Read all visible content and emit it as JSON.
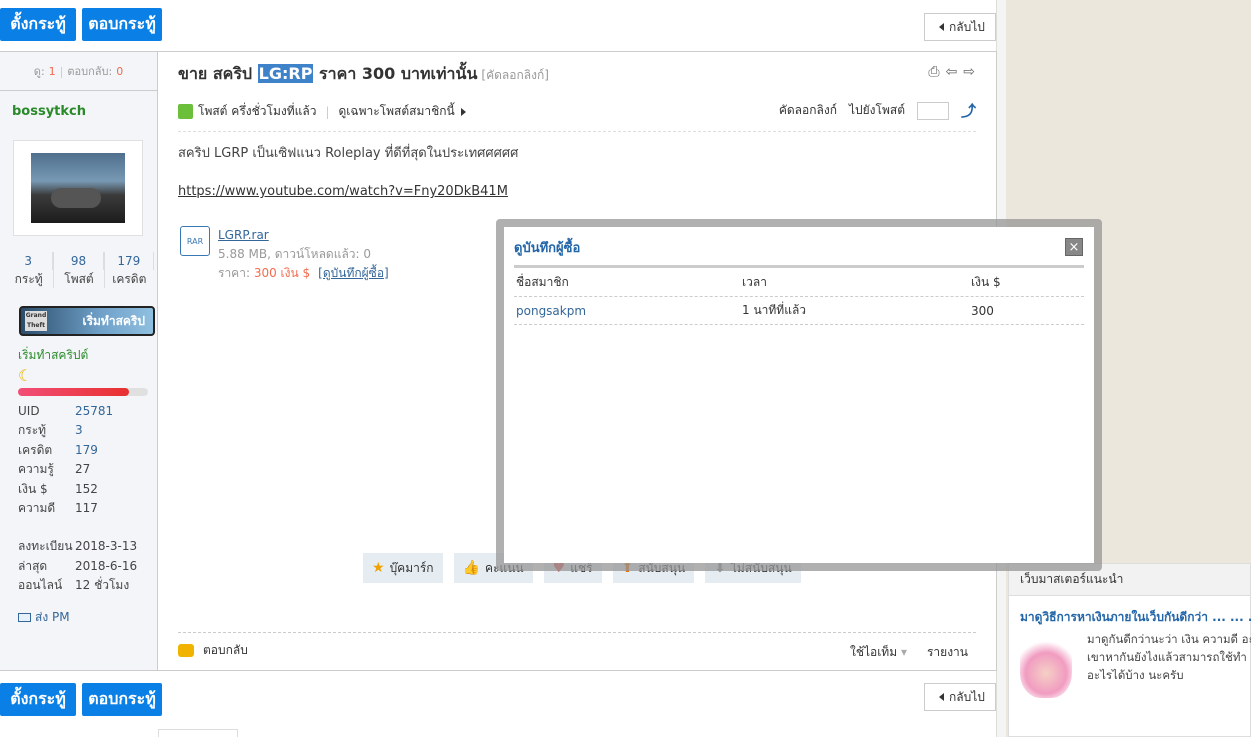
{
  "toolbar": {
    "new_thread": "ตั้งกระทู้",
    "reply": "ตอบกระทู้",
    "back": "กลับไป"
  },
  "left": {
    "views_label": "ดู:",
    "views": "1",
    "replies_label": "ตอบกลับ:",
    "replies": "0",
    "username": "bossytkch",
    "stats": [
      {
        "value": "3",
        "label": "กระทู้"
      },
      {
        "value": "98",
        "label": "โพสต์"
      },
      {
        "value": "179",
        "label": "เครดิต"
      }
    ],
    "badge_text": "เริ่มทำสคริป",
    "rank_title": "เริ่มทำสคริปต์",
    "progress": 0.85,
    "info": [
      {
        "k": "UID",
        "v": "25781"
      },
      {
        "k": "กระทู้",
        "v": "3"
      },
      {
        "k": "เครดิต",
        "v": "179"
      },
      {
        "k": "ความรู้",
        "v": "27"
      },
      {
        "k": "เงิน $",
        "v": "152"
      },
      {
        "k": "ความดี",
        "v": "117"
      }
    ],
    "info2": [
      {
        "k": "ลงทะเบียน",
        "v": "2018-3-13"
      },
      {
        "k": "ล่าสุด",
        "v": "2018-6-16"
      },
      {
        "k": "ออนไลน์",
        "v": "12 ชั่วโมง"
      }
    ],
    "pm": "ส่ง PM"
  },
  "post": {
    "title_prefix": "ขาย สคริป",
    "title_highlight": "LG:RP",
    "title_suffix": "ราคา 300 บาทเท่านั้น",
    "copy_link_small": "[คัดลอกลิงก์]",
    "posted_time": "โพสต์ ครึ่งชั่วโมงที่แล้ว",
    "only_member": "ดูเฉพาะโพสต์สมาชิกนี้",
    "copy_link": "คัดลอกลิงก์",
    "goto_post": "ไปยังโพสต์",
    "body": "สคริป LGRP เป็นเซิฟแนว Roleplay ที่ดีที่สุดในประเทศศศศศ",
    "link": "https://www.youtube.com/watch?v=Fny20DkB41M",
    "attach": {
      "icon_text": "RAR",
      "name": "LGRP.rar",
      "size": "5.88 MB, ดาวน์โหลดแล้ว: 0",
      "price_label": "ราคา:",
      "price": "300 เงิน $",
      "buyers": "[ดูบันทึกผู้ซื้อ]"
    },
    "actions": [
      "บุ๊คมาร์ก",
      "คะแนน",
      "แชร์",
      "สนับสนุน",
      "ไม่สนับสนุน"
    ],
    "reply": "ตอบกลับ",
    "use_item": "ใช้ไอเท็ม",
    "report": "รายงาน"
  },
  "modal": {
    "title": "ดูบันทึกผู้ซื้อ",
    "close": "×",
    "headers": [
      "ชื่อสมาชิก",
      "เวลา",
      "เงิน $"
    ],
    "rows": [
      {
        "member": "pongsakpm",
        "time": "1 นาทีที่แล้ว",
        "amount": "300"
      }
    ]
  },
  "sidebar": {
    "heading": "เว็บมาสเตอร์แนะนำ",
    "link": "มาดูวิธีการหาเงินภายในเว็บกันดีกว่า ... ... ...",
    "text_lines": [
      "มาดูกันดีกว่านะว่า เงิน ความดี อะไร",
      "เขาหากันยังไงแล้วสามารถใช้ทำ",
      "อะไรได้บ้าง นะครับ"
    ]
  }
}
